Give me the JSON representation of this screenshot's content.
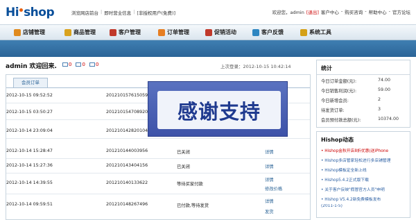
{
  "header": {
    "logo_hi": "Hi",
    "logo_shop": "shop",
    "links": [
      "浏览网店前台",
      "即时营业信息",
      "[非授权用户(免费)]"
    ],
    "user_prefix": "欢迎您，admin",
    "exit": "[退出]",
    "user_links": [
      "客户中心",
      "购买咨询",
      "帮助中心",
      "官方论坛"
    ]
  },
  "nav": {
    "items": [
      {
        "label": "店铺管理",
        "icon": "store-icon",
        "color": "#e08a1e"
      },
      {
        "label": "商品管理",
        "icon": "goods-icon",
        "color": "#d9a21d"
      },
      {
        "label": "客户管理",
        "icon": "customer-icon",
        "color": "#c0392b"
      },
      {
        "label": "订单管理",
        "icon": "order-icon",
        "color": "#e67e22"
      },
      {
        "label": "促销活动",
        "icon": "promo-icon",
        "color": "#c0392b"
      },
      {
        "label": "客户反馈",
        "icon": "feedback-icon",
        "color": "#2e86c1"
      },
      {
        "label": "系统工具",
        "icon": "tools-icon",
        "color": "#d4a017"
      }
    ]
  },
  "main": {
    "welcome": "admin 欢迎回来.",
    "msg_counts": [
      "0",
      "0",
      "0"
    ],
    "last_login": "上次登录：2012-10-15  10:42:14",
    "tab": "会员订单",
    "rows": [
      {
        "time": "2012-10-15 09:52:52",
        "order": "2012101576150​59",
        "status": "",
        "action": "",
        "action2": ""
      },
      {
        "time": "2012-10-15 03:50:27",
        "order": "201210154708920",
        "status": "",
        "action": "",
        "action2": ""
      },
      {
        "time": "2012-10-14 23:09:04",
        "order": "201210142820104",
        "status": "",
        "action": "",
        "action2": ""
      },
      {
        "time": "2012-10-14 15:28:47",
        "order": "201210144003956",
        "status": "已关闭",
        "action": "详情",
        "action2": ""
      },
      {
        "time": "2012-10-14 15:27:36",
        "order": "201210143404156",
        "status": "已关闭",
        "action": "详情",
        "action2": ""
      },
      {
        "time": "2012-10-14 14:39:55",
        "order": "201210140133622",
        "status": "等待买家付款",
        "action": "详情",
        "action2": "修改价格"
      },
      {
        "time": "2012-10-14 09:59:51",
        "order": "201210148267496",
        "status": "已付款,等待发货",
        "action": "详情",
        "action2": "发货"
      }
    ],
    "banner_text": "感谢支持"
  },
  "stats": {
    "title": "统计",
    "rows": [
      {
        "label": "今日订单金额(元):",
        "value": "74.00"
      },
      {
        "label": "今日销售利润(元):",
        "value": "59.00"
      },
      {
        "label": "今日新增会员:",
        "value": "2"
      },
      {
        "label": "待发货订单:",
        "value": "3"
      },
      {
        "label": "会员预付款总额(元):",
        "value": "10374.00"
      }
    ]
  },
  "news": {
    "title": "Hishop动态",
    "items": [
      {
        "text": "• Hishop金秋开店8折优惠(送iPhone",
        "red": true
      },
      {
        "text": "• Hishop多店管家轻松进行多店铺管理",
        "red": false
      },
      {
        "text": "• Hishop模板定全新上线",
        "red": false
      },
      {
        "text": "• Hishop5.4.2正式版下载",
        "red": false
      },
      {
        "text": "• 关于客户反映\"假冒官方人员\"申明",
        "red": false
      },
      {
        "text": "• Hishop V5.4.2新免费模板发布",
        "red": false
      },
      {
        "text": "  (2011-1-5)",
        "red": false
      }
    ]
  }
}
